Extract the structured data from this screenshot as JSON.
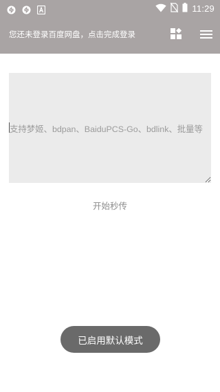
{
  "status_bar": {
    "time": "11:29",
    "left_icons": [
      "sync-icon",
      "sync-icon",
      "notification-a-icon"
    ],
    "right_icons": [
      "wifi-icon",
      "no-sim-icon",
      "battery-icon"
    ]
  },
  "toolbar": {
    "login_hint": "您还未登录百度网盘，点击完成登录",
    "apps_icon": "apps-icon",
    "menu_icon": "menu-icon",
    "background_color": "#a9a4a4"
  },
  "main": {
    "input_placeholder": "支持梦姬、bdpan、BaiduPCS-Go、bdlink、批量等",
    "input_value": "",
    "start_button_label": "开始秒传"
  },
  "toast": {
    "message": "已启用默认模式"
  }
}
